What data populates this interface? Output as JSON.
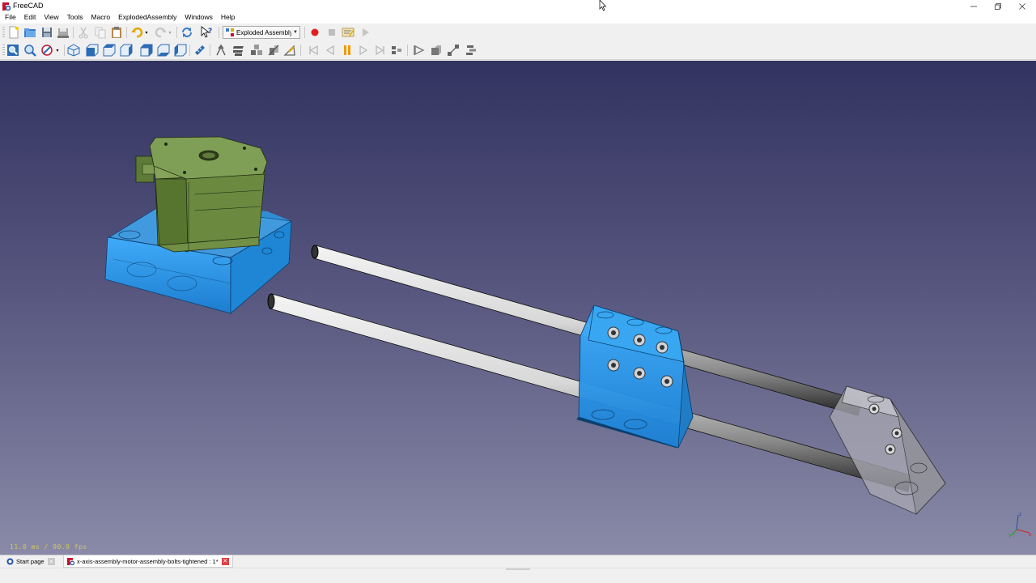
{
  "window": {
    "title": "FreeCAD",
    "accent": "#c8102e"
  },
  "menu": {
    "items": [
      "File",
      "Edit",
      "View",
      "Tools",
      "Macro",
      "ExplodedAssembly",
      "Windows",
      "Help"
    ]
  },
  "toolbar": {
    "workbench_selected": "Exploded Assembly",
    "file_icons": [
      "new-document-icon",
      "open-icon",
      "save-icon",
      "save-as-icon",
      "cut-icon",
      "copy-icon",
      "paste-icon",
      "undo-icon",
      "redo-icon",
      "refresh-icon",
      "whats-this-icon"
    ],
    "macro_icons": [
      "record-macro-icon",
      "stop-macro-icon",
      "edit-macro-icon",
      "run-macro-icon"
    ],
    "view_icons": [
      "fit-all-icon",
      "fit-selection-icon",
      "draw-style-icon",
      "isometric-icon",
      "front-view-icon",
      "top-view-icon",
      "right-view-icon",
      "rear-view-icon",
      "bottom-view-icon",
      "left-view-icon",
      "measure-icon"
    ],
    "explode_icons": [
      "create-group-icon",
      "bolt-group-icon",
      "simple-group-icon",
      "wire-group-icon",
      "edit-trajectory-icon",
      "go-to-start-icon",
      "previous-step-icon",
      "pause-icon",
      "play-icon",
      "go-to-end-icon",
      "go-to-selected-icon",
      "animation-camera-icon",
      "place-before-icon",
      "align-icon",
      "stack-icon"
    ]
  },
  "viewport": {
    "fps_text": "11.0 ms / 90.9 fps",
    "axis_labels": {
      "x": "x",
      "y": "y",
      "z": "z"
    }
  },
  "tabs": [
    {
      "label": "Start page",
      "active": false
    },
    {
      "label": "x-axis-assembly-motor-assembly-bolts-tightened : 1*",
      "active": true
    }
  ]
}
